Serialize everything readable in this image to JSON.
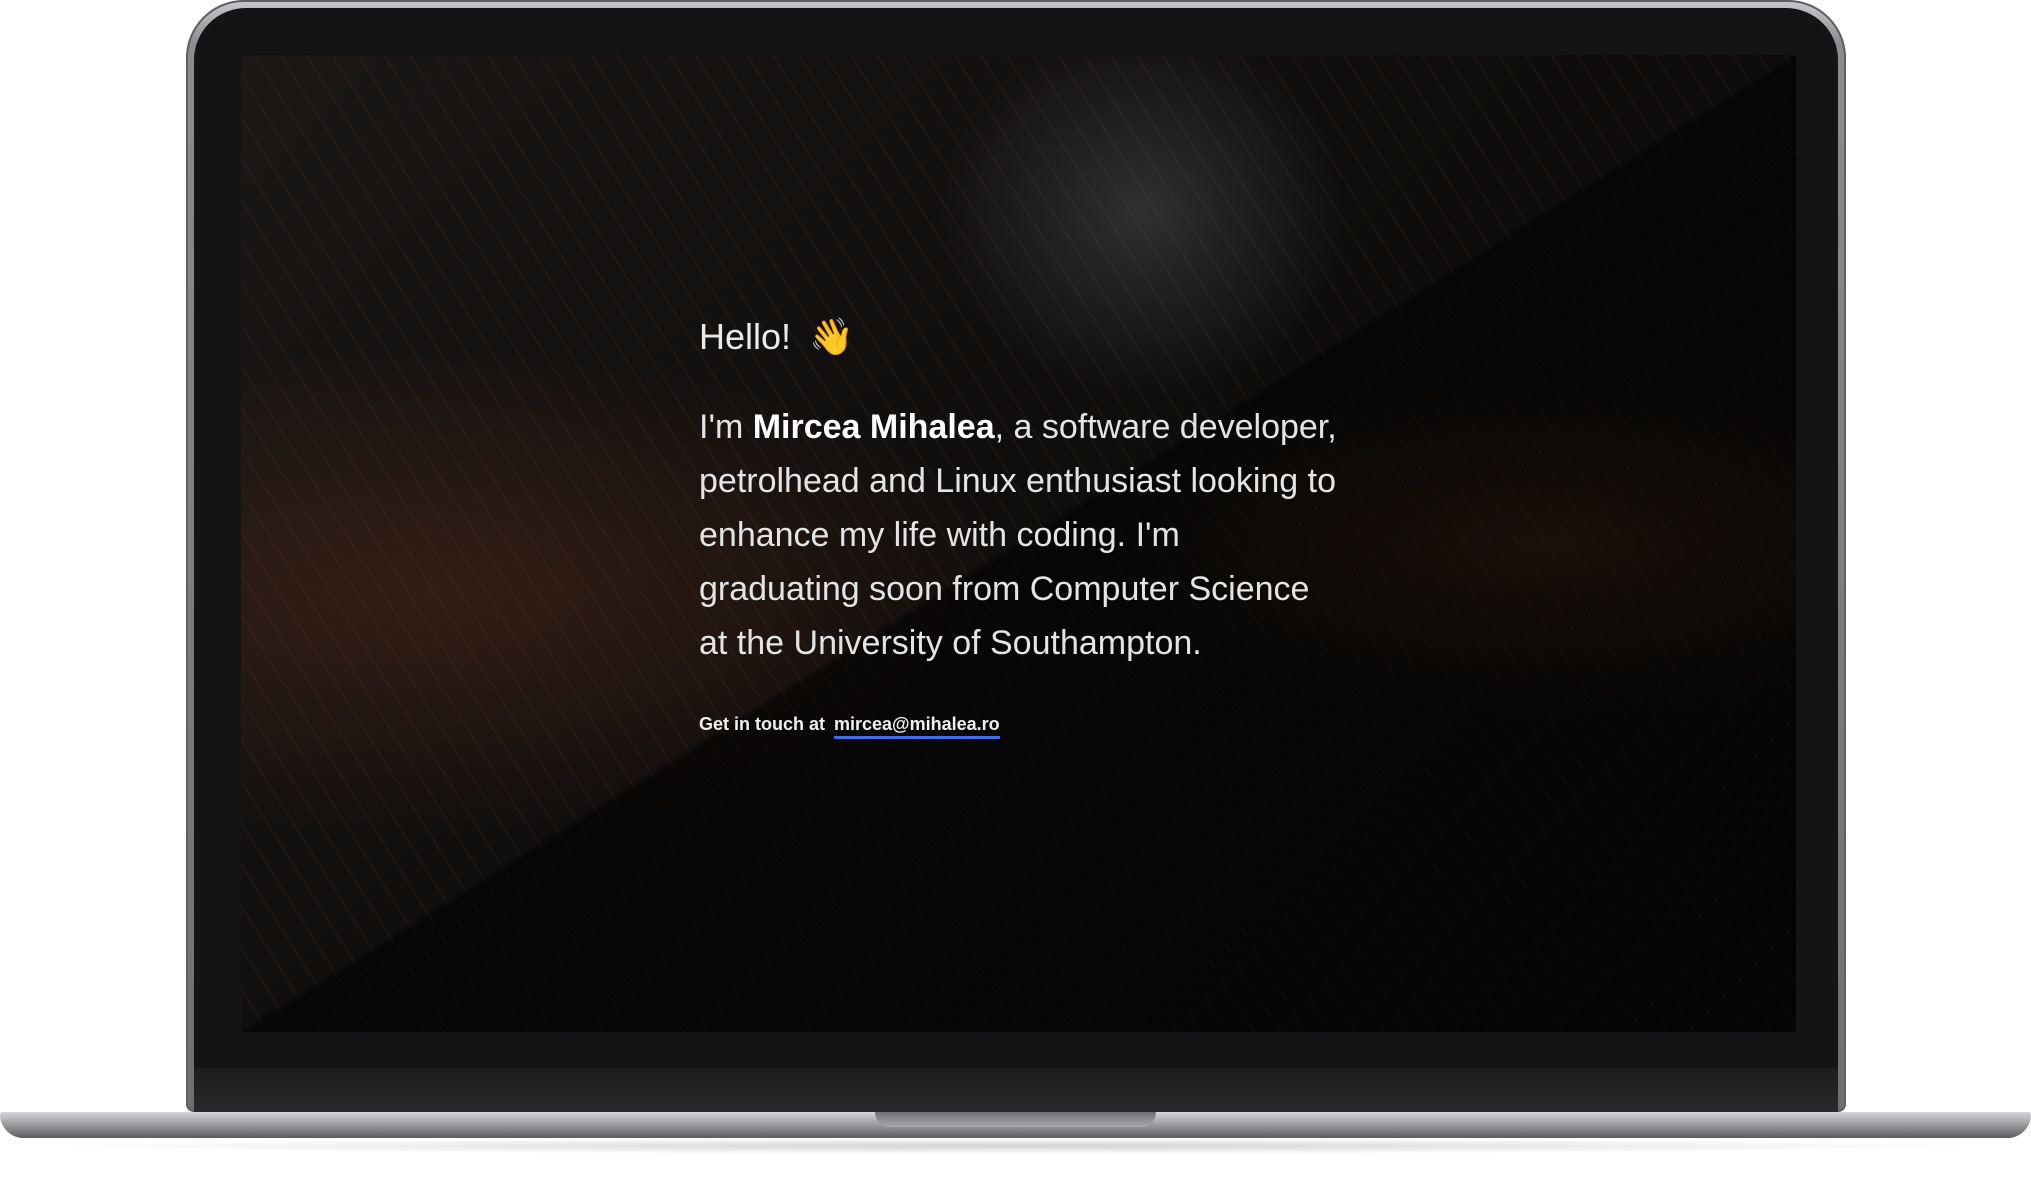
{
  "page": {
    "greeting": "Hello!",
    "greeting_icon": "waving-hand-icon",
    "greeting_emoji": "👋",
    "intro_prefix": "I'm ",
    "name": "Mircea Mihalea",
    "intro_rest": ", a software developer, petrolhead and Linux enthusiast looking to enhance my life with coding. I'm graduating soon from Computer Science at the University of Southampton.",
    "contact_prefix": "Get in touch at",
    "email": "mircea@mihalea.ro"
  },
  "colors": {
    "background": "#0b0b0c",
    "text": "#e4e4e4",
    "link_underline": "#3f6fe6"
  }
}
